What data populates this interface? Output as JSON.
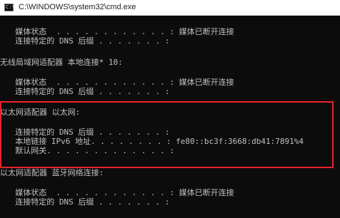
{
  "window": {
    "title": "C:\\WINDOWS\\system32\\cmd.exe",
    "icon": "cmd-icon",
    "icon_glyph": "C:\\"
  },
  "console": {
    "lines": [
      "  媒体状态  . . . . . . . . . . . . : 媒体已断开连接",
      "  连接特定的 DNS 后缀 . . . . . . . :",
      "无线局域网适配器 本地连接* 10:",
      "  媒体状态  . . . . . . . . . . . . : 媒体已断开连接",
      "  连接特定的 DNS 后缀 . . . . . . . :",
      "以太网适配器 以太网:",
      "  连接特定的 DNS 后缀 . . . . . . . :",
      "  本地链接 IPv6 地址. . . . . . . . : fe80::bc3f:3668:db41:7891%4",
      "  默认网关. . . . . . . . . . . . . :",
      "以太网适配器 蓝牙网络连接:",
      "  媒体状态  . . . . . . . . . . . . : 媒体已断开连接",
      "  连接特定的 DNS 后缀 . . . . . . . :"
    ]
  },
  "colors": {
    "console_background": "#0c0c0c",
    "console_text": "#c0c0c0",
    "highlight_border": "#e8232a",
    "titlebar_background": "#ffffff"
  }
}
